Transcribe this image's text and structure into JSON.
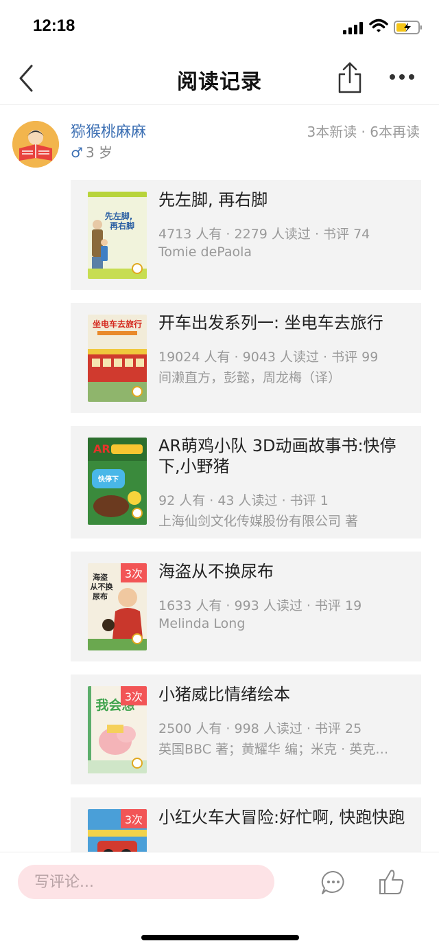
{
  "status_bar": {
    "time": "12:18"
  },
  "nav": {
    "title": "阅读记录"
  },
  "profile": {
    "name": "猕猴桃麻麻",
    "gender_symbol": "♂",
    "age": "3 岁",
    "stats": "3本新读 · 6本再读"
  },
  "books": [
    {
      "title": "先左脚, 再右脚",
      "stats": "4713 人有 · 2279 人读过 · 书评 74",
      "author": "Tomie dePaola",
      "times": "",
      "cover_text": "先左脚，再右脚"
    },
    {
      "title": "开车出发系列一: 坐电车去旅行",
      "stats": "19024 人有 · 9043 人读过 · 书评 99",
      "author": "间濑直方，彭懿，周龙梅（译）",
      "times": "",
      "cover_text": "坐电车去旅行"
    },
    {
      "title": "AR萌鸡小队 3D动画故事书:快停下,小野猪",
      "stats": "92 人有 · 43 人读过 · 书评 1",
      "author": "上海仙剑文化传媒股份有限公司 著",
      "times": "",
      "cover_text": "快停下，小野猪"
    },
    {
      "title": "海盗从不换尿布",
      "stats": "1633 人有 · 993 人读过 · 书评 19",
      "author": "Melinda Long",
      "times": "3次",
      "cover_text": "海盗从不换尿布"
    },
    {
      "title": "小猪威比情绪绘本",
      "stats": "2500 人有 · 998 人读过 · 书评 25",
      "author": "英国BBC 著；黄耀华 编；米克 · 英克…",
      "times": "3次",
      "cover_text": "我会想"
    },
    {
      "title": "小红火车大冒险:好忙啊, 快跑快跑",
      "stats": "",
      "author": "",
      "times": "3次",
      "cover_text": ""
    }
  ],
  "bottom_bar": {
    "comment_placeholder": "写评论..."
  },
  "colors": {
    "accent_blue": "#3c6fb3",
    "badge_red": "#f25556",
    "comment_bg": "#fde3e6",
    "card_bg": "#f3f3f3"
  },
  "icons": [
    "back-icon",
    "share-icon",
    "more-icon",
    "comment-icon",
    "like-icon",
    "male-icon"
  ]
}
